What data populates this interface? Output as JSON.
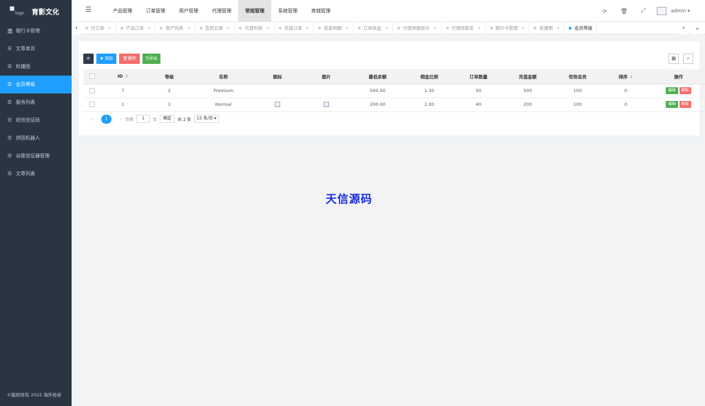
{
  "brand": {
    "logo_alt": "logo",
    "name": "育影文化"
  },
  "sidebar": {
    "items": [
      {
        "label": "银行卡管理",
        "icon": "bank-icon"
      },
      {
        "label": "文章单页",
        "icon": "list-icon"
      },
      {
        "label": "轮播图",
        "icon": "list-icon"
      },
      {
        "label": "会员等级",
        "icon": "list-icon",
        "active": true
      },
      {
        "label": "服务列表",
        "icon": "list-icon"
      },
      {
        "label": "短信验证码",
        "icon": "list-icon"
      },
      {
        "label": "拼团机器人",
        "icon": "list-icon"
      },
      {
        "label": "谷歌验证器管理",
        "icon": "list-icon"
      },
      {
        "label": "文章列表",
        "icon": "list-icon"
      }
    ],
    "copyright": "©版权所有 2022 海外抢单"
  },
  "topnav": {
    "items": [
      "产品管理",
      "订单管理",
      "用户管理",
      "代理管理",
      "常规管理",
      "系统管理",
      "商城管理"
    ],
    "active": "常规管理",
    "user": "admin"
  },
  "tabs": {
    "items": [
      "付订单",
      "产品订单",
      "用户列表",
      "签到记录",
      "代理列表",
      "充值订单",
      "资金明细",
      "订单收益",
      "代理表报统计",
      "代理线裂变",
      "银行卡管理",
      "轮播图",
      "会员等级"
    ],
    "active": "会员等级"
  },
  "toolbar": {
    "add": "添加",
    "delete": "删除",
    "export": "导出"
  },
  "table": {
    "columns": [
      "ID",
      "等级",
      "名称",
      "图标",
      "图片",
      "最低余额",
      "佣金比例",
      "订单数量",
      "充值金额",
      "有效会员",
      "排序",
      "操作"
    ],
    "rows": [
      {
        "id": "7",
        "level": "2",
        "name": "Premium",
        "icon": false,
        "image": false,
        "min_balance": "500.00",
        "commission": "1.30",
        "orders": "50",
        "recharge": "500",
        "members": "100",
        "sort": "0"
      },
      {
        "id": "1",
        "level": "1",
        "name": "Normal",
        "icon": true,
        "image": true,
        "min_balance": "200.00",
        "commission": "1.00",
        "orders": "40",
        "recharge": "200",
        "members": "100",
        "sort": "0"
      }
    ],
    "edit_label": "编辑",
    "delete_label": "删除"
  },
  "pagination": {
    "current_page": "1",
    "goto_label": "到第",
    "page_value": "1",
    "page_unit": "页",
    "confirm": "确定",
    "total": "共 2 条",
    "page_size": "15 条/页"
  },
  "watermark": "天信源码",
  "colors": {
    "sidebar_bg": "#2a3542",
    "accent": "#1e9fff",
    "danger": "#f56c6c",
    "success": "#4caf50"
  }
}
